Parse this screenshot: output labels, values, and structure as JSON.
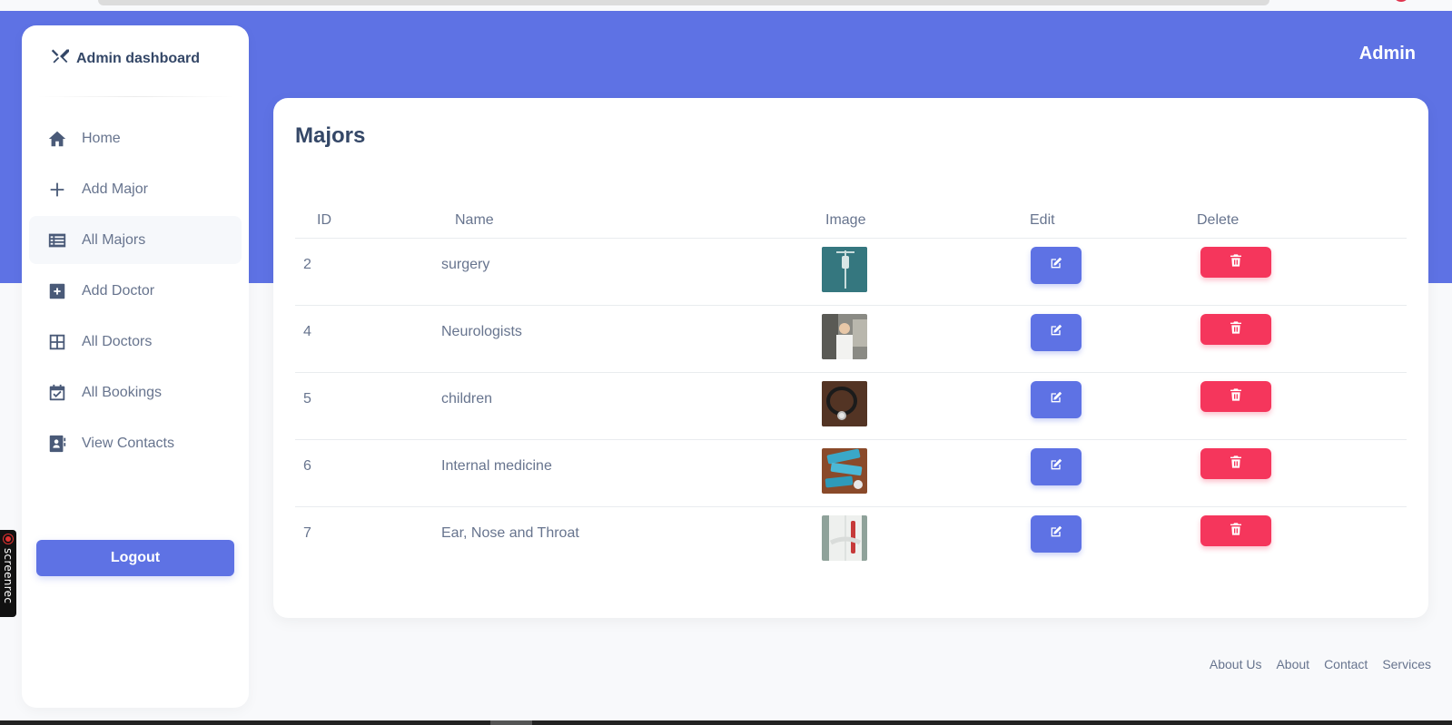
{
  "header": {
    "user_label": "Admin"
  },
  "sidebar": {
    "brand": "Admin dashboard",
    "items": [
      {
        "label": "Home",
        "icon": "home-icon",
        "active": false
      },
      {
        "label": "Add Major",
        "icon": "plus-icon",
        "active": false
      },
      {
        "label": "All Majors",
        "icon": "list-icon",
        "active": true
      },
      {
        "label": "Add Doctor",
        "icon": "plus-square-icon",
        "active": false
      },
      {
        "label": "All Doctors",
        "icon": "grid-icon",
        "active": false
      },
      {
        "label": "All Bookings",
        "icon": "calendar-check-icon",
        "active": false
      },
      {
        "label": "View Contacts",
        "icon": "contact-card-icon",
        "active": false
      }
    ],
    "logout_label": "Logout"
  },
  "main": {
    "title": "Majors",
    "table": {
      "columns": [
        "ID",
        "Name",
        "Image",
        "Edit",
        "Delete"
      ],
      "rows": [
        {
          "id": "2",
          "name": "surgery",
          "image": "surgery-thumbnail"
        },
        {
          "id": "4",
          "name": "Neurologists",
          "image": "neurologists-thumbnail"
        },
        {
          "id": "5",
          "name": "children",
          "image": "children-thumbnail"
        },
        {
          "id": "6",
          "name": "Internal medicine",
          "image": "internal-medicine-thumbnail"
        },
        {
          "id": "7",
          "name": "Ear, Nose and Throat",
          "image": "ent-thumbnail"
        }
      ]
    }
  },
  "footer": {
    "links": [
      "About Us",
      "About",
      "Contact",
      "Services"
    ]
  },
  "overlay": {
    "recorder_label": "screenrec"
  },
  "colors": {
    "primary": "#5e72e4",
    "danger": "#f5365c",
    "text": "#344767",
    "muted": "#67748e"
  }
}
